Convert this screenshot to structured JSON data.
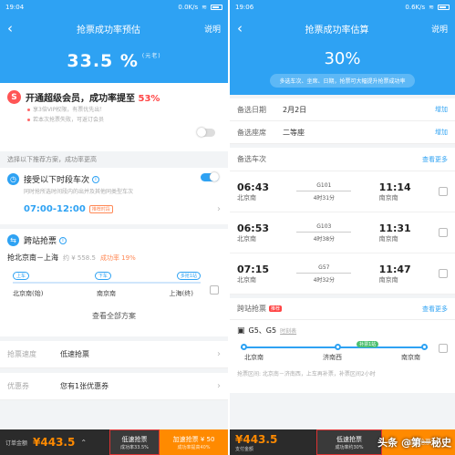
{
  "left": {
    "status": {
      "time": "19:04",
      "net": "0.0K/s"
    },
    "title": "抢票成功率预估",
    "help": "说明",
    "percent": "33.5 %",
    "percent_note": "(元老)",
    "vip": {
      "icon": "S",
      "title_pre": "开通超级会员，成功率提至",
      "title_pct": "53%",
      "bullets": [
        "享3倍VIP权限，有票优先出！",
        "若本次抢票失败，可返订会员"
      ]
    },
    "section_hint": "选择以下推荐方案，成功率更高",
    "accept": {
      "title": "接受以下时段车次",
      "sub": "同时抢所选时间段内的出并及其他同类型车次",
      "range": "07:00-12:00",
      "badge": "推荐时段"
    },
    "cross": {
      "title": "跨站抢票",
      "route": "抢北京南－上海",
      "price": "约 ¥ 558.5",
      "rate": "成功率 19%",
      "tags": [
        "上车",
        "下车",
        "多抢1站"
      ],
      "stations": [
        "北京南(始)",
        "南京南",
        "上海(终)"
      ]
    },
    "all_plans": "查看全部方案",
    "speed": {
      "label": "抢票速度",
      "value": "低速抢票"
    },
    "coupon": {
      "label": "优惠券",
      "value": "您有1张优惠券"
    },
    "bottom": {
      "label": "订单金额",
      "price": "¥443.5",
      "btn1": "低速抢票",
      "btn1_sub": "成功率33.5%",
      "btn2": "加速抢票 ¥ 50",
      "btn2_sub": "成功率提高40%"
    }
  },
  "right": {
    "status": {
      "time": "19:06",
      "net": "0.6K/s"
    },
    "title": "抢票成功率估算",
    "help": "说明",
    "percent": "30%",
    "pill": "多选车次、坐席、日期，抢票可大幅提升抢票成功率",
    "date": {
      "label": "备选日期",
      "value": "2月2日",
      "action": "增加"
    },
    "seat": {
      "label": "备选座席",
      "value": "二等座",
      "action": "增加"
    },
    "trains_label": "备选车次",
    "trains_more": "查看更多",
    "trains": [
      {
        "dep": "06:43",
        "from": "北京南",
        "no": "G101",
        "dur": "4时31分",
        "arr": "11:14",
        "to": "南京南"
      },
      {
        "dep": "06:53",
        "from": "北京南",
        "no": "G103",
        "dur": "4时38分",
        "arr": "11:31",
        "to": "南京南"
      },
      {
        "dep": "07:15",
        "from": "北京南",
        "no": "G57",
        "dur": "4时32分",
        "arr": "11:47",
        "to": "南京南"
      }
    ],
    "cross": {
      "label": "跨站抢票",
      "badge": "推荐",
      "more": "查看更多"
    },
    "route": {
      "trains": "G5、G5",
      "link": "时刻表",
      "tag": "补票1站",
      "stations": [
        "北京南",
        "济南西",
        "南京南"
      ],
      "note": "抢票区间: 北京南－济南西，上车再补票，补票区间2小时"
    },
    "bottom": {
      "price": "¥443.5",
      "price_sub": "支付金额",
      "btn1": "低速抢票",
      "btn1_sub": "成功率约30%",
      "btn2": "加速抢票",
      "watermark": "头条 @第一秘史"
    }
  }
}
